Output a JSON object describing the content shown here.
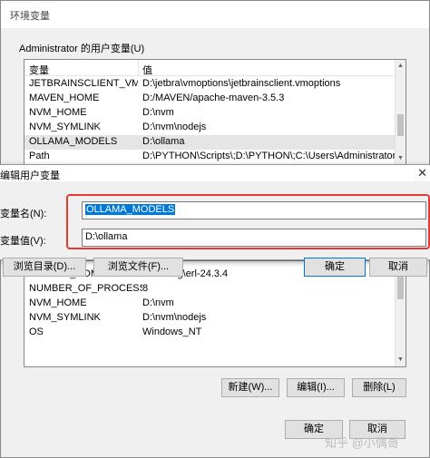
{
  "env_dialog": {
    "title": "环境变量",
    "user_vars_label": "Administrator 的用户变量(U)",
    "columns": [
      "变量",
      "值"
    ],
    "user_vars": [
      {
        "name": "JETBRAINSCLIENT_VM_O...",
        "value": "D:\\jetbra\\vmoptions\\jetbrainsclient.vmoptions"
      },
      {
        "name": "MAVEN_HOME",
        "value": "D:/MAVEN/apache-maven-3.5.3"
      },
      {
        "name": "NVM_HOME",
        "value": "D:\\nvm"
      },
      {
        "name": "NVM_SYMLINK",
        "value": "D:\\nvm\\nodejs"
      },
      {
        "name": "OLLAMA_MODELS",
        "value": "D:\\ollama"
      },
      {
        "name": "Path",
        "value": "D:\\PYTHON\\Scripts\\;D:\\PYTHON\\;C:\\Users\\Administrator\\App..."
      }
    ],
    "system_vars": [
      {
        "name": "ERLANG_HOME",
        "value": "D:\\erlang\\erl-24.3.4"
      },
      {
        "name": "NUMBER_OF_PROCESSORS",
        "value": "8"
      },
      {
        "name": "NVM_HOME",
        "value": "D:\\nvm"
      },
      {
        "name": "NVM_SYMLINK",
        "value": "D:\\nvm\\nodejs"
      },
      {
        "name": "OS",
        "value": "Windows_NT"
      }
    ],
    "system_buttons": {
      "new": "新建(W)...",
      "edit": "编辑(I)...",
      "delete": "删除(L)"
    },
    "ok_label": "确定",
    "cancel_label": "取消"
  },
  "edit_dialog": {
    "title": "编辑用户变量",
    "name_label": "变量名(N):",
    "value_label": "变量值(V):",
    "name_value": "OLLAMA_MODELS",
    "value_value": "D:\\ollama",
    "browse_dir_label": "浏览目录(D)...",
    "browse_file_label": "浏览文件(F)...",
    "ok_label": "确定",
    "cancel_label": "取消"
  },
  "watermark": "知乎 @小偶哥",
  "colors": {
    "highlight": "#e53935",
    "selection": "#0078d7"
  }
}
